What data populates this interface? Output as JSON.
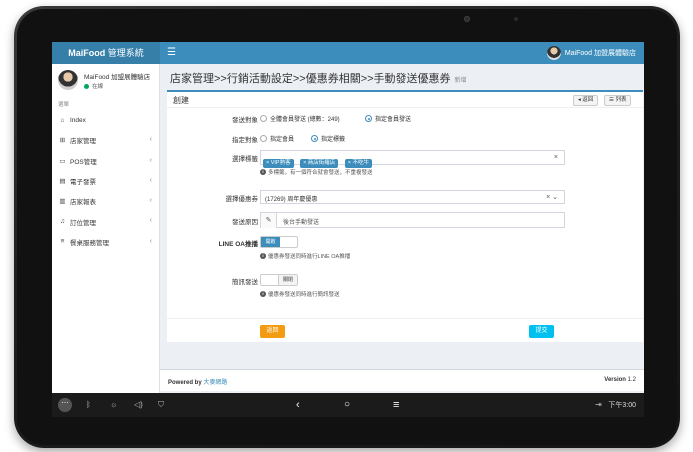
{
  "header": {
    "brand_bold": "MaiFood",
    "brand_rest": " 管理系統",
    "menu_icon": "☰",
    "user_name": "MaiFood 加盟展體驗店"
  },
  "sidebar": {
    "user_name": "MaiFood 加盟展體驗店",
    "status": "在線",
    "menu_header": "選單",
    "items": [
      {
        "icon": "home-icon",
        "glyph": "⌂",
        "label": "Index",
        "chevron": ""
      },
      {
        "icon": "sitemap-icon",
        "glyph": "⊞",
        "label": "店家管理",
        "chevron": "‹"
      },
      {
        "icon": "monitor-icon",
        "glyph": "▭",
        "label": "POS管理",
        "chevron": "‹"
      },
      {
        "icon": "invoice-icon",
        "glyph": "▤",
        "label": "電子發票",
        "chevron": "‹"
      },
      {
        "icon": "bar-chart-icon",
        "glyph": "▥",
        "label": "店家報表",
        "chevron": "‹"
      },
      {
        "icon": "bell-icon",
        "glyph": "♫",
        "label": "訂位管理",
        "chevron": "‹"
      },
      {
        "icon": "list-icon",
        "glyph": "≡",
        "label": "餐桌服務管理",
        "chevron": "‹"
      }
    ]
  },
  "content": {
    "title": "店家管理>>行銷活動設定>>優惠券相關>>手動發送優惠券",
    "subtitle": "新增",
    "box_title": "創建",
    "back_btn": "◂ 返回",
    "list_btn": "☰ 列表",
    "send_target": {
      "label": "發送對象",
      "options": [
        "全體會員發送 (總數：249)",
        "指定會員發送"
      ],
      "selected": 1
    },
    "assign_target": {
      "label": "指定對象",
      "options": [
        "指定會員",
        "指定標籤"
      ],
      "selected": 1
    },
    "tags": {
      "label": "選擇標籤",
      "values": [
        "× VIP熟客",
        "× 商店街羅店",
        "× 不吃牛"
      ],
      "clear": "×",
      "help": "多標籤，有一個符合就會發送，不重複發送"
    },
    "coupon": {
      "label": "選擇優惠券",
      "value": "(17269) 周年慶優惠",
      "controls": "× ⌄"
    },
    "reason": {
      "label": "發送原因",
      "value": "後台手動發送"
    },
    "line_oa": {
      "label": "LINE OA推播",
      "on": "開啟",
      "help": "優惠券發送同時進行LINE OA推播"
    },
    "sms": {
      "label": "簡訊發送",
      "off": "關閉",
      "help": "優惠券發送同時進行簡訊發送"
    },
    "back_label": "返回",
    "submit_label": "提交"
  },
  "footer": {
    "powered": "Powered by ",
    "link": "大麥網路",
    "version_label": "Version",
    "version": "1.2"
  },
  "android": {
    "time": "下午3:00"
  }
}
